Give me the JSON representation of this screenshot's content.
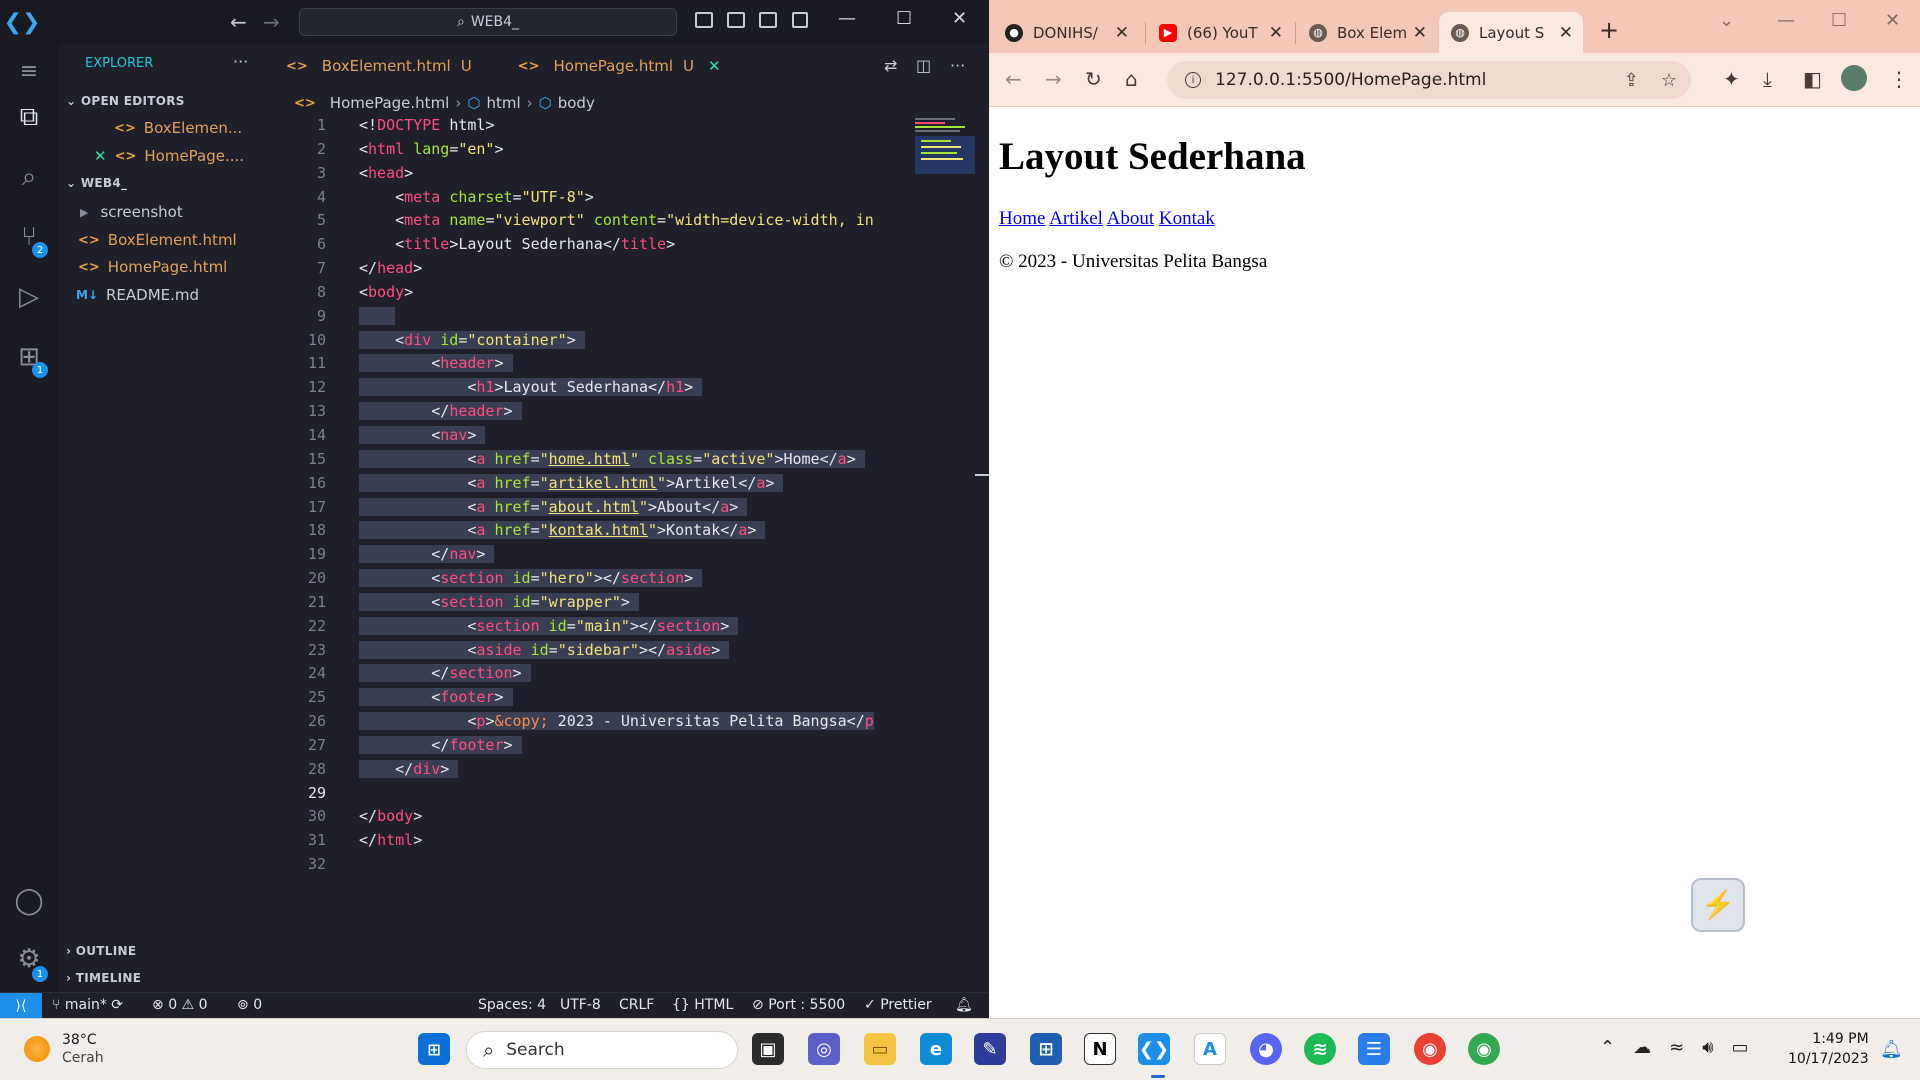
{
  "vscode": {
    "title_search": "WEB4_",
    "sidebar": {
      "title": "EXPLORER",
      "open_editors_label": "OPEN EDITORS",
      "open_editors": [
        {
          "name": "BoxElemen...",
          "status": "U"
        },
        {
          "name": "HomePage....",
          "status": "U"
        }
      ],
      "folder_label": "WEB4_",
      "files": [
        {
          "name": "screenshot",
          "status": ""
        },
        {
          "name": "BoxElement.html",
          "status": "U"
        },
        {
          "name": "HomePage.html",
          "status": "U"
        },
        {
          "name": "README.md",
          "status": ""
        }
      ],
      "outline_label": "OUTLINE",
      "timeline_label": "TIMELINE"
    },
    "activity_badges": {
      "source_control": "2",
      "extensions": "1",
      "settings": "1"
    },
    "tabs": [
      {
        "name": "BoxElement.html",
        "status": "U"
      },
      {
        "name": "HomePage.html",
        "status": "U"
      }
    ],
    "breadcrumb": [
      "HomePage.html",
      "html",
      "body"
    ],
    "status": {
      "branch": "main*",
      "errors": "0",
      "warnings": "0",
      "ports": "0",
      "spaces": "Spaces: 4",
      "encoding": "UTF-8",
      "eol": "CRLF",
      "language": "HTML",
      "port": "Port : 5500",
      "formatter": "Prettier"
    }
  },
  "browser": {
    "tabs": [
      {
        "title": "DONIHS/",
        "icon": "github-icon"
      },
      {
        "title": "(66) YouT",
        "icon": "youtube-icon"
      },
      {
        "title": "Box Elem",
        "icon": "globe-icon"
      },
      {
        "title": "Layout S",
        "icon": "globe-icon"
      }
    ],
    "url": "127.0.0.1:5500/HomePage.html",
    "page": {
      "heading": "Layout Sederhana",
      "nav": [
        "Home",
        "Artikel",
        "About",
        "Kontak"
      ],
      "footer": "© 2023 - Universitas Pelita Bangsa"
    }
  },
  "taskbar": {
    "temperature": "38°C",
    "weather": "Cerah",
    "search_placeholder": "Search",
    "time": "1:49 PM",
    "date": "10/17/2023"
  },
  "colors": {
    "vscode_bg": "#1e1f28",
    "tag": "#ff4d7e",
    "attr": "#a3e635",
    "string": "#f3e27a",
    "modified": "#e2a15a",
    "browser_frame": "#f4c8b6",
    "link": "#0000ee"
  }
}
